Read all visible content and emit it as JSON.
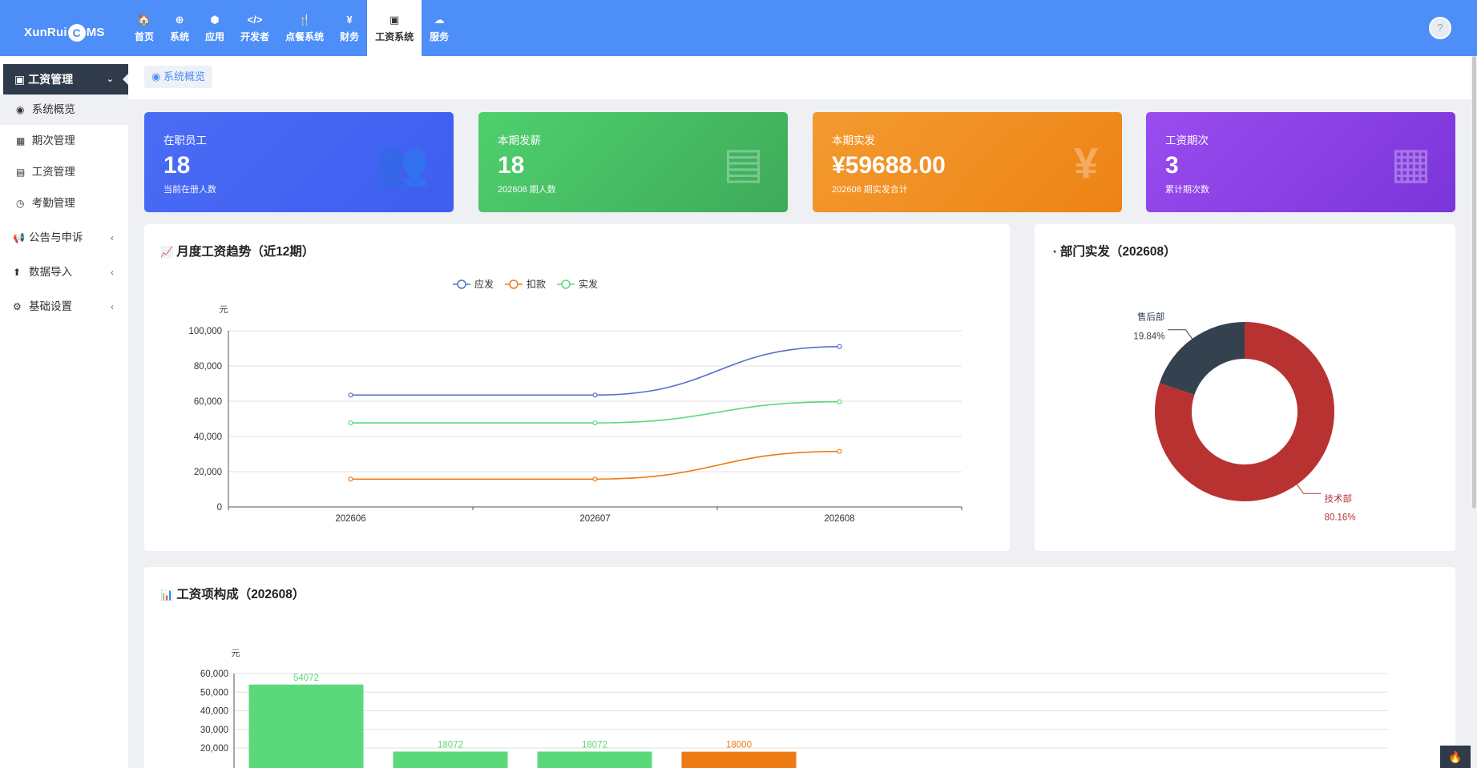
{
  "brand": {
    "logo_text_pre": "XunRui",
    "logo_c": "C",
    "logo_text_post": "MS"
  },
  "nav": [
    {
      "icon": "🏠",
      "label": "首页"
    },
    {
      "icon": "⊕",
      "label": "系统"
    },
    {
      "icon": "⬢",
      "label": "应用"
    },
    {
      "icon": "</>",
      "label": "开发者"
    },
    {
      "icon": "🍴",
      "label": "点餐系统"
    },
    {
      "icon": "¥",
      "label": "财务"
    },
    {
      "icon": "▣",
      "label": "工资系统"
    },
    {
      "icon": "☁",
      "label": "服务"
    }
  ],
  "sidebar": {
    "head": "工资管理",
    "subs": [
      {
        "icon": "◉",
        "label": "系统概览"
      },
      {
        "icon": "▦",
        "label": "期次管理"
      },
      {
        "icon": "▤",
        "label": "工资管理"
      },
      {
        "icon": "◷",
        "label": "考勤管理"
      }
    ],
    "groups": [
      {
        "icon": "📢",
        "label": "公告与申诉"
      },
      {
        "icon": "⬆",
        "label": "数据导入"
      },
      {
        "icon": "⚙",
        "label": "基础设置"
      }
    ]
  },
  "breadcrumb": "系统概览",
  "cards": [
    {
      "label": "在职员工",
      "value": "18",
      "sub": "当前在册人数",
      "icon": "👥",
      "color_from": "#4b6cf5",
      "color_to": "#3d5df0"
    },
    {
      "label": "本期发薪",
      "value": "18",
      "sub": "202608 期人数",
      "icon": "▤",
      "color_from": "#4fd06d",
      "color_to": "#3eaa5a"
    },
    {
      "label": "本期实发",
      "value": "¥59688.00",
      "sub": "202608 期实发合计",
      "icon": "¥",
      "color_from": "#f39a2f",
      "color_to": "#ee8316"
    },
    {
      "label": "工资期次",
      "value": "3",
      "sub": "累计期次数",
      "icon": "▦",
      "color_from": "#9a4cf0",
      "color_to": "#7a35d8"
    }
  ],
  "trend": {
    "title": "月度工资趋势（近12期）",
    "title_icon": "📈",
    "yunit": "元"
  },
  "dept": {
    "title": "部门实发（202608）",
    "title_icon": "◔"
  },
  "items": {
    "title": "工资项构成（202608）",
    "title_icon": "📊",
    "yunit": "元"
  },
  "chart_data": [
    {
      "type": "line",
      "title": "月度工资趋势（近12期）",
      "ylabel": "元",
      "x": [
        "202606",
        "202607",
        "202608"
      ],
      "series": [
        {
          "name": "应发",
          "values": [
            63500,
            63500,
            91000
          ],
          "color": "#5470c6"
        },
        {
          "name": "扣款",
          "values": [
            15800,
            15800,
            31500
          ],
          "color": "#ee7a14"
        },
        {
          "name": "实发",
          "values": [
            47700,
            47700,
            59688
          ],
          "color": "#5bd97a"
        }
      ],
      "ylim": [
        0,
        100000
      ],
      "yticks": [
        "0",
        "20,000",
        "40,000",
        "60,000",
        "80,000",
        "100,000"
      ],
      "legend": "top-center",
      "grid": true
    },
    {
      "type": "pie",
      "title": "部门实发（202608）",
      "donut": true,
      "slices": [
        {
          "name": "技术部",
          "percent": 80.16,
          "label": "80.16%",
          "color": "#b83232"
        },
        {
          "name": "售后部",
          "percent": 19.84,
          "label": "19.84%",
          "color": "#34414f"
        }
      ]
    },
    {
      "type": "bar",
      "title": "工资项构成（202608）",
      "ylabel": "元",
      "values": [
        54072,
        18072,
        18072,
        18000
      ],
      "value_labels": [
        "54072",
        "18072",
        "18072",
        "18000"
      ],
      "colors": [
        "#5bd97a",
        "#5bd97a",
        "#5bd97a",
        "#ee7a14"
      ],
      "ylim": [
        0,
        60000
      ],
      "yticks": [
        "20,000",
        "30,000",
        "40,000",
        "50,000",
        "60,000"
      ],
      "grid": true
    }
  ]
}
